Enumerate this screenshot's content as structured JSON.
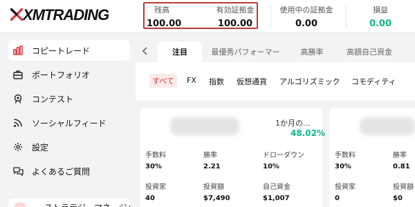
{
  "header": {
    "logo_text": "XMTRADING",
    "stats": [
      {
        "label": "残高",
        "value": "100.00",
        "highlight": true
      },
      {
        "label": "有効証拠金",
        "value": "100.00",
        "highlight": true
      },
      {
        "label": "使用中の証拠金",
        "value": "0.00",
        "highlight": false
      },
      {
        "label": "損益",
        "value": "0.00",
        "color": "#0fb58b"
      }
    ],
    "highlight_color": "#b53a3a"
  },
  "sidebar": {
    "items": [
      {
        "label": "コピートレード",
        "icon": "bar-chart-icon",
        "active": true
      },
      {
        "label": "ポートフォリオ",
        "icon": "briefcase-icon"
      },
      {
        "label": "コンテスト",
        "icon": "medal-icon"
      },
      {
        "label": "ソーシャルフィード",
        "icon": "rss-icon"
      },
      {
        "label": "設定",
        "icon": "gear-icon"
      },
      {
        "label": "よくあるご質問",
        "icon": "chat-bubbles-icon"
      }
    ],
    "bottom_label": "ストラテジーマネージャ"
  },
  "main": {
    "tabs": [
      {
        "label": "注目",
        "active": true
      },
      {
        "label": "最優秀パフォーマー"
      },
      {
        "label": "高勝率"
      },
      {
        "label": "高額自己資金"
      }
    ],
    "filters": [
      "すべて",
      "FX",
      "指数",
      "仮想通貨",
      "アルゴリズミック",
      "コモディティ"
    ],
    "cards": [
      {
        "period_label": "1か月の...",
        "return_value": "48.02%",
        "metrics": [
          {
            "label": "手数料",
            "value": "30%"
          },
          {
            "label": "勝率",
            "value": "2.21"
          },
          {
            "label": "ドローダウン",
            "value": "10%"
          },
          {
            "label": "投資家",
            "value": "40"
          },
          {
            "label": "投資額",
            "value": "$7,490"
          },
          {
            "label": "自己資金",
            "value": "$1,007"
          }
        ]
      },
      {
        "metrics": [
          {
            "label": "手数料",
            "value": "30%"
          },
          {
            "label": "勝率",
            "value": "0.81"
          },
          {
            "label": "投資家",
            "value": "0"
          },
          {
            "label": "投資額",
            "value": "$0"
          }
        ]
      }
    ]
  },
  "colors": {
    "accent_green": "#0fb58b",
    "accent_red": "#d9303a"
  }
}
